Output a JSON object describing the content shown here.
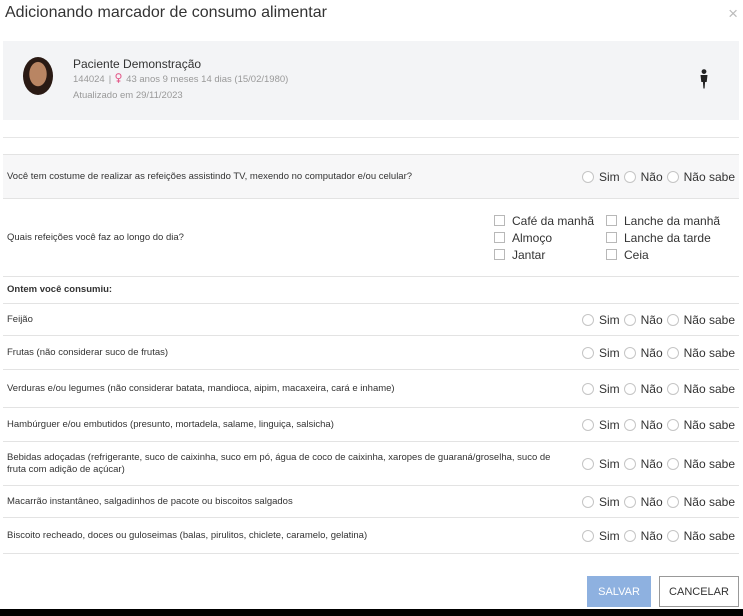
{
  "modal": {
    "title": "Adicionando marcador de consumo alimentar",
    "close_glyph": "×"
  },
  "patient": {
    "name": "Paciente Demonstração",
    "id": "144024",
    "separator": "|",
    "age": "43 anos 9 meses 14 dias (15/02/1980)",
    "updated": "Atualizado em 29/11/2023",
    "avatar_icon": "avatar",
    "sex_icon": "female-icon",
    "body_icon": "person-icon"
  },
  "options": [
    "Sim",
    "Não",
    "Não sabe"
  ],
  "q_screens": "Você tem costume de realizar as refeições assistindo TV, mexendo no computador e/ou celular?",
  "q_meals": "Quais refeições você faz ao longo do dia?",
  "meals": [
    "Café da manhã",
    "Lanche da manhã",
    "Almoço",
    "Lanche da tarde",
    "Jantar",
    "Ceia"
  ],
  "section_yesterday": "Ontem você consumiu:",
  "foods": [
    "Feijão",
    "Frutas (não considerar suco de frutas)",
    "Verduras e/ou legumes (não considerar batata, mandioca, aipim, macaxeira, cará e inhame)",
    "Hambúrguer e/ou embutidos (presunto, mortadela, salame, linguiça, salsicha)",
    "Bebidas adoçadas (refrigerante, suco de caixinha, suco em pó, água de coco de caixinha, xaropes de guaraná/groselha, suco de fruta com adição de açúcar)",
    "Macarrão instantâneo, salgadinhos de pacote ou biscoitos salgados",
    "Biscoito recheado, doces ou guloseimas (balas, pirulitos, chiclete, caramelo, gelatina)"
  ],
  "buttons": {
    "save": "SALVAR",
    "cancel": "CANCELAR"
  },
  "colors": {
    "save_bg": "#8eb1e0",
    "row_alt": "#f7f7f8",
    "female": "#e35c8b"
  }
}
